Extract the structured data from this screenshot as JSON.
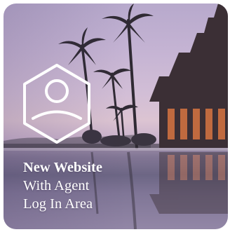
{
  "promo": {
    "headline": "New Website",
    "subline_1": "With Agent",
    "subline_2": "Log In Area",
    "icon": "agent-profile-hexagon-icon"
  },
  "colors": {
    "sky_top": "#b7a9cc",
    "sky_horizon": "#dcc4d2",
    "water": "#6d6685",
    "text": "#ffffff"
  }
}
